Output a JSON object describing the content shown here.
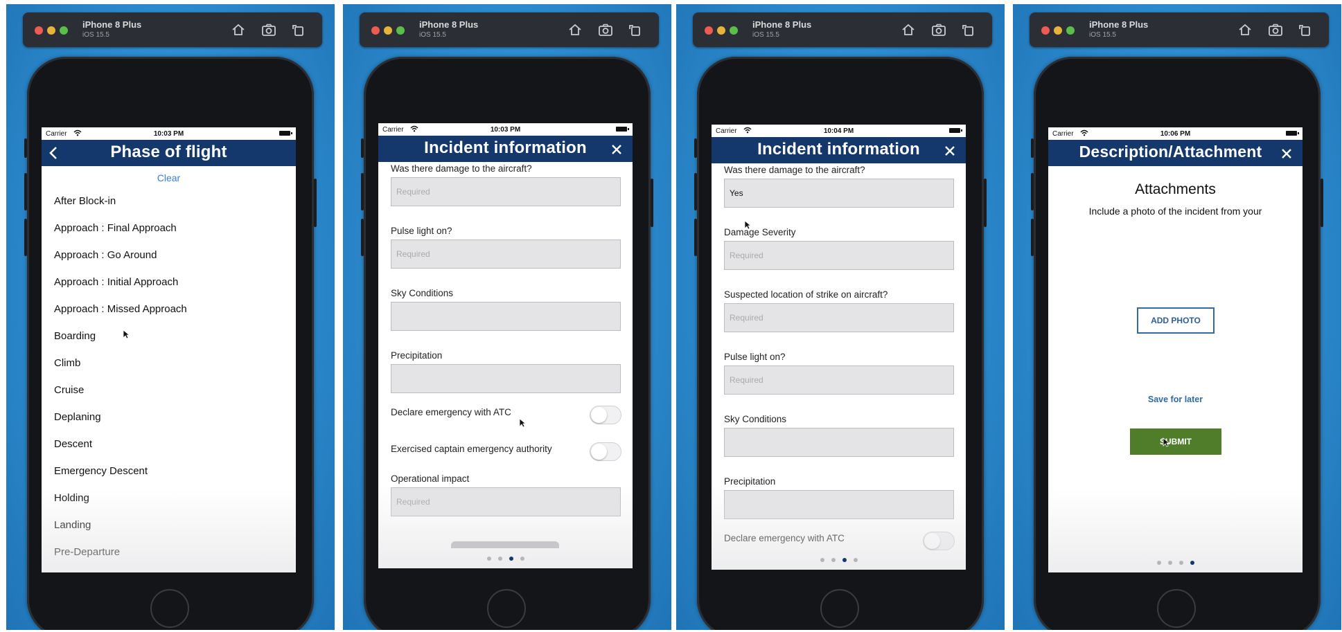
{
  "simulator": {
    "device_name": "iPhone 8 Plus",
    "os_version": "iOS 15.5"
  },
  "screens": [
    {
      "status": {
        "carrier": "Carrier",
        "time": "10:03 PM"
      },
      "title": "Phase of flight",
      "clear_label": "Clear",
      "items": [
        "After Block-in",
        "Approach : Final Approach",
        "Approach : Go Around",
        "Approach : Initial Approach",
        "Approach : Missed Approach",
        "Boarding",
        "Climb",
        "Cruise",
        "Deplaning",
        "Descent",
        "Emergency Descent",
        "Holding",
        "Landing",
        "Pre-Departure"
      ]
    },
    {
      "status": {
        "carrier": "Carrier",
        "time": "10:03 PM"
      },
      "title": "Incident information",
      "fields": [
        {
          "label": "Was there damage to the aircraft?",
          "placeholder": "Required",
          "value": ""
        },
        {
          "label": "Pulse light on?",
          "placeholder": "Required",
          "value": ""
        },
        {
          "label": "Sky Conditions",
          "placeholder": "",
          "value": ""
        },
        {
          "label": "Precipitation",
          "placeholder": "",
          "value": ""
        }
      ],
      "toggles": [
        {
          "label": "Declare emergency with ATC",
          "on": false
        },
        {
          "label": "Exercised captain emergency authority",
          "on": false
        }
      ],
      "last_field": {
        "label": "Operational impact",
        "placeholder": "Required",
        "value": ""
      },
      "page_index": 3,
      "page_count": 4
    },
    {
      "status": {
        "carrier": "Carrier",
        "time": "10:04 PM"
      },
      "title": "Incident information",
      "fields": [
        {
          "label": "Was there damage to the aircraft?",
          "placeholder": "",
          "value": "Yes"
        },
        {
          "label": "Damage Severity",
          "placeholder": "Required",
          "value": ""
        },
        {
          "label": "Suspected location of strike on aircraft?",
          "placeholder": "Required",
          "value": ""
        },
        {
          "label": "Pulse light on?",
          "placeholder": "Required",
          "value": ""
        },
        {
          "label": "Sky Conditions",
          "placeholder": "",
          "value": ""
        },
        {
          "label": "Precipitation",
          "placeholder": "",
          "value": ""
        }
      ],
      "toggles": [
        {
          "label": "Declare emergency with ATC",
          "on": false
        }
      ],
      "page_index": 3,
      "page_count": 4
    },
    {
      "status": {
        "carrier": "Carrier",
        "time": "10:06 PM"
      },
      "title": "Description/Attachment",
      "attachments_title": "Attachments",
      "attachments_desc": "Include a photo of the incident from your",
      "add_photo_label": "ADD PHOTO",
      "save_later_label": "Save for later",
      "submit_label": "SUBMIT",
      "page_index": 4,
      "page_count": 4
    }
  ],
  "colors": {
    "nav_bar": "#14386b",
    "link": "#3b7cd8",
    "submit": "#4f7d2a",
    "field_bg": "#e4e4e6"
  }
}
